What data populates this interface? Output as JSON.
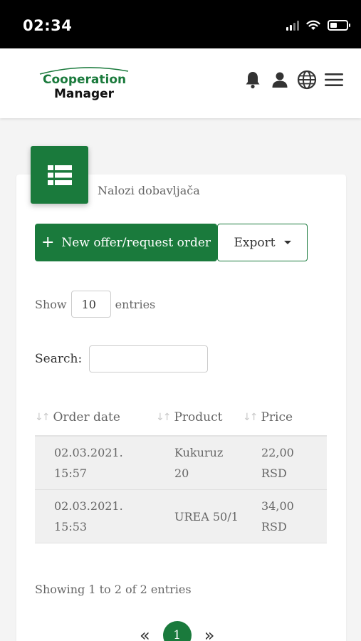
{
  "status_bar": {
    "time": "02:34"
  },
  "header": {
    "logo_line1": "Cooperation",
    "logo_line2": "Manager",
    "icons": [
      "bell-icon",
      "user-icon",
      "globe-icon",
      "menu-icon"
    ]
  },
  "card": {
    "title": "Nalozi dobavljača",
    "icon": "list-icon"
  },
  "buttons": {
    "new_order": "New offer/request order",
    "export": "Export"
  },
  "length": {
    "show_label": "Show",
    "value": "10",
    "entries_label": "entries"
  },
  "search": {
    "label": "Search:",
    "value": ""
  },
  "table": {
    "columns": [
      "Order date",
      "Product",
      "Price"
    ],
    "rows": [
      {
        "date": "02.03.2021.\n15:57",
        "product": "Kukuruz\n20",
        "price": "22,00\nRSD"
      },
      {
        "date": "02.03.2021.\n15:53",
        "product": "UREA 50/1",
        "price": "34,00\nRSD"
      }
    ]
  },
  "info": "Showing 1 to 2 of 2 entries",
  "pagination": {
    "prev": "«",
    "current": "1",
    "next": "»"
  },
  "colors": {
    "brand_green": "#1a7a3c"
  }
}
